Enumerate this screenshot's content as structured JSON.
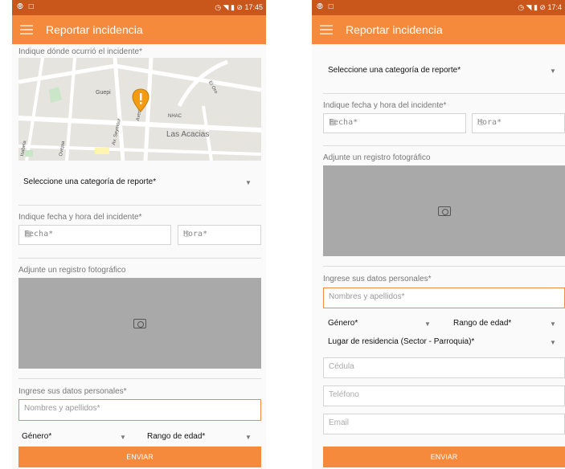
{
  "status": {
    "left_icons": "⦾ □",
    "left": {
      "time": "17:45"
    },
    "right": {
      "time": "17:4"
    }
  },
  "app": {
    "title": "Reportar incidencia"
  },
  "left": {
    "map_label": "Indique dónde ocurrió el incidente*",
    "map_places": [
      "Guepi",
      "Avenida de",
      "Av. Seymour",
      "Las Acacias",
      "NHAC",
      "El Oro",
      "Isabela",
      "Ovejaa"
    ],
    "category": "Seleccione una categoría de reporte*",
    "date_label": "Indique fecha y hora del incidente*",
    "fecha_placeholder": "Fecha*",
    "hora_placeholder": "Hora*",
    "photo_label": "Adjunte un registro fotográfico",
    "personal_label": "Ingrese sus datos personales*",
    "name_placeholder": "Nombres y apellidos*",
    "gender": "Género*",
    "age": "Rango de edad*",
    "submit": "ENVIAR"
  },
  "right": {
    "category": "Seleccione una categoría de reporte*",
    "date_label": "Indique fecha y hora del incidente*",
    "fecha_placeholder": "Fecha*",
    "hora_placeholder": "Hora*",
    "photo_label": "Adjunte un registro fotográfico",
    "personal_label": "Ingrese sus datos personales*",
    "name_placeholder": "Nombres y apellidos*",
    "gender": "Género*",
    "age": "Rango de edad*",
    "residence": "Lugar de residencia (Sector - Parroquia)*",
    "cedula_placeholder": "Cédula",
    "phone_placeholder": "Teléfono",
    "email_placeholder": "Email",
    "submit": "ENVIAR"
  },
  "colors": {
    "accent": "#f58a3c",
    "statusbar": "#c9561b",
    "photo": "#a9a9a9"
  }
}
